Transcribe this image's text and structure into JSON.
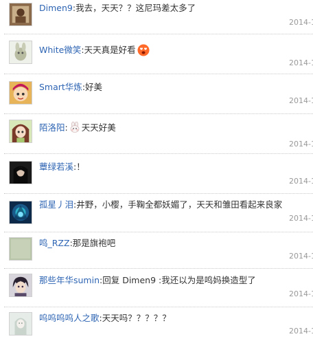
{
  "replies": [
    {
      "username": "Dimen9",
      "colon": ":",
      "content": "我去，天天？？这尼玛差太多了",
      "time": "2014-1",
      "avatar": "avatar-dimen9"
    },
    {
      "username": "White微笑",
      "colon": ":",
      "content": "天天真是好看",
      "time": "2014-1",
      "avatar": "avatar-white",
      "emoji": "heart-eyes-emoji"
    },
    {
      "username": "Smart华炼",
      "colon": ":",
      "content": "好美",
      "time": "2014-1",
      "avatar": "avatar-smart"
    },
    {
      "username": "陌洛阳",
      "colon": ":",
      "content": "天天好美",
      "time": "2014-1",
      "avatar": "avatar-moluoyang",
      "emoji": "bunny-emoji"
    },
    {
      "username": "蕈绿若溪",
      "colon": ":",
      "content": "！",
      "time": "2014-1",
      "avatar": "avatar-xunlv"
    },
    {
      "username": "孤星丿泪",
      "colon": ":",
      "content": "井野，小樱，手鞠全都妖媚了，天天和雏田看起来良家",
      "time": "2014-1",
      "avatar": "avatar-guxing"
    },
    {
      "username": "鸣_RZZ",
      "colon": ":",
      "content": "那是旗袍吧",
      "time": "2014-1",
      "avatar": "avatar-ming"
    },
    {
      "username": "那些年华sumin",
      "colon": ":",
      "content": "回复  Dimen9 :我还以为是鸣妈换造型了",
      "time": "2014-1",
      "avatar": "avatar-sumin"
    },
    {
      "username": "呜呜呜呜人之歌",
      "colon": ":",
      "content": "天天吗？？？？？",
      "time": "2014-1",
      "avatar": "avatar-wuwu"
    }
  ],
  "colors": {
    "username": "#2d64b3",
    "text": "#333333",
    "time": "#999999",
    "separator": "#c8c8c8"
  }
}
